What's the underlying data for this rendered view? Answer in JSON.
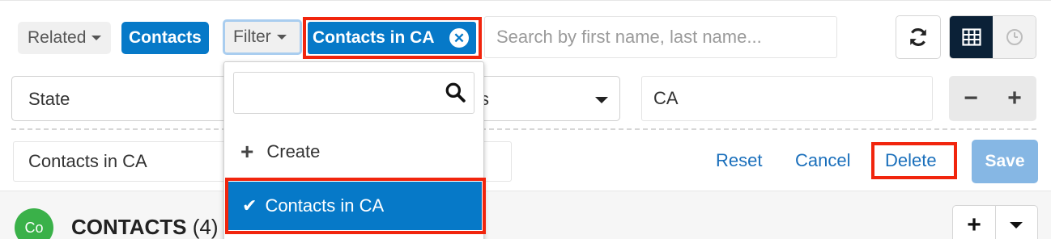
{
  "toolbar": {
    "related_label": "Related",
    "module_label": "Contacts",
    "filter_label": "Filter",
    "active_filter_label": "Contacts in CA",
    "search_placeholder": "Search by first name, last name..."
  },
  "filter_row": {
    "field_label": "State",
    "operator_fragment": "s",
    "value": "CA"
  },
  "filter_name": {
    "value": "Contacts in CA",
    "reset_label": "Reset",
    "cancel_label": "Cancel",
    "delete_label": "Delete",
    "save_label": "Save"
  },
  "dropdown": {
    "search_value": "",
    "create_label": "Create",
    "selected_label": "Contacts in CA"
  },
  "list": {
    "avatar_initials": "Co",
    "title": "CONTACTS",
    "count": "(4)"
  },
  "icons": {
    "refresh": "refresh-icon",
    "grid": "grid-view-icon",
    "clock": "activity-stream-icon",
    "clear": "clear-filter-icon",
    "search": "search-icon",
    "plus": "plus-icon",
    "check": "checkmark-icon"
  },
  "colors": {
    "accent": "#0679c8",
    "highlight": "#f1250d",
    "link": "#1a6fbb",
    "save_disabled": "#86b7e4",
    "avatar": "#3ab149"
  }
}
